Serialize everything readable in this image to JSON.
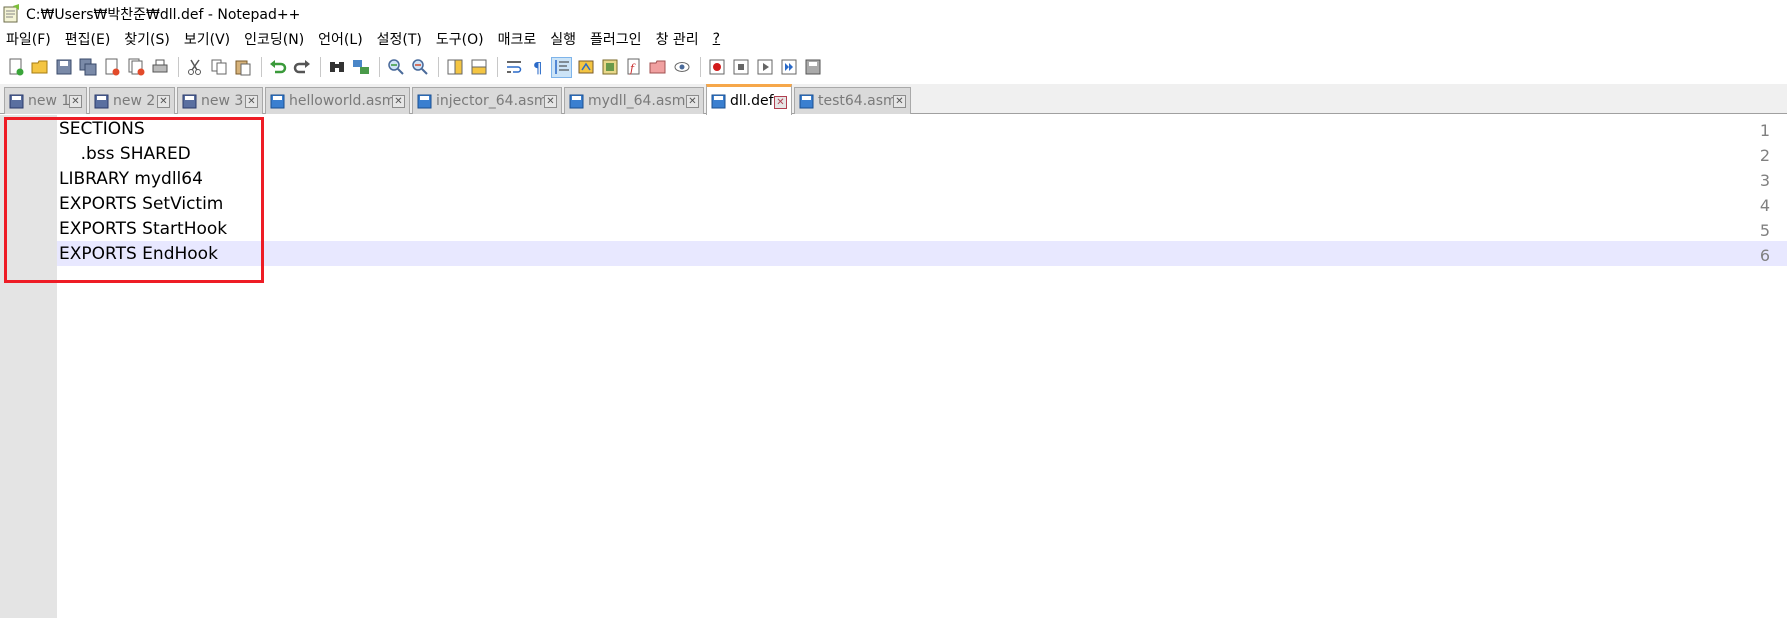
{
  "window": {
    "title": "C:₩Users₩박찬준₩dll.def - Notepad++"
  },
  "menu": [
    "파일(F)",
    "편집(E)",
    "찾기(S)",
    "보기(V)",
    "인코딩(N)",
    "언어(L)",
    "설정(T)",
    "도구(O)",
    "매크로",
    "실행",
    "플러그인",
    "창 관리",
    "?"
  ],
  "tabs": [
    {
      "label": "new 1"
    },
    {
      "label": "new 2"
    },
    {
      "label": "new 3"
    },
    {
      "label": "helloworld.asm"
    },
    {
      "label": "injector_64.asm"
    },
    {
      "label": "mydll_64.asm"
    },
    {
      "label": "dll.def"
    },
    {
      "label": "test64.asm"
    }
  ],
  "editor": {
    "lines": [
      {
        "num": "1",
        "text": "SECTIONS"
      },
      {
        "num": "2",
        "text": "    .bss SHARED"
      },
      {
        "num": "3",
        "text": "LIBRARY mydll64"
      },
      {
        "num": "4",
        "text": "EXPORTS SetVictim"
      },
      {
        "num": "5",
        "text": "EXPORTS StartHook"
      },
      {
        "num": "6",
        "text": "EXPORTS EndHook"
      }
    ]
  },
  "colors": {
    "active_tab_accent": "#f6a74a",
    "highlight_box": "#ee1c25",
    "current_line": "#e8e8ff"
  }
}
